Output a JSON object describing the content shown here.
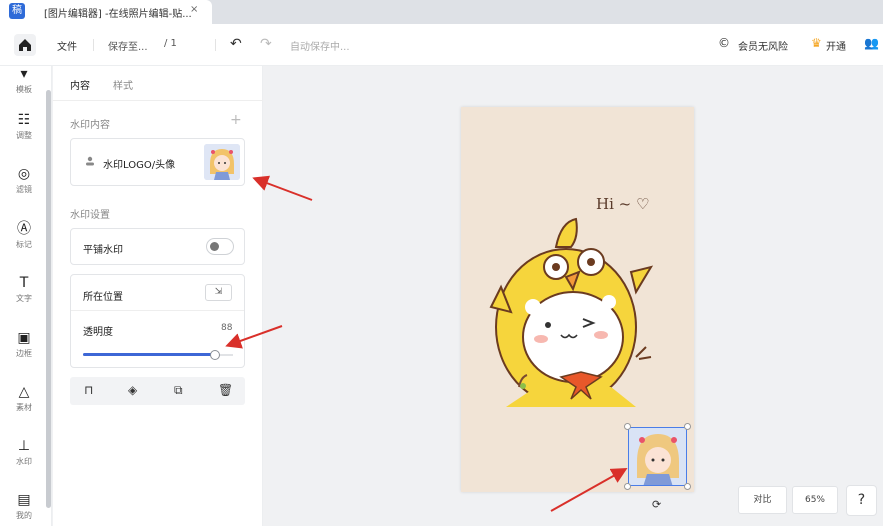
{
  "tab": {
    "logo": "稿",
    "title": "[图片编辑器] -在线照片编辑-贴...",
    "close": "×"
  },
  "toolbar": {
    "file": "文件",
    "save": "保存至...",
    "page": "/ 1",
    "undo": "↶",
    "redo": "↷",
    "autosave": "自动保存中...",
    "copyright_icon": "©",
    "member": "会员无风险",
    "vip_icon": "♛",
    "vip": "开通",
    "user_icon": "👥"
  },
  "nav": {
    "items": [
      {
        "icon": "▾",
        "label": "模板"
      },
      {
        "icon": "☷",
        "label": "调整"
      },
      {
        "icon": "◎",
        "label": "滤镜"
      },
      {
        "icon": "Ⓐ",
        "label": "标记"
      },
      {
        "icon": "T",
        "label": "文字"
      },
      {
        "icon": "▣",
        "label": "边框"
      },
      {
        "icon": "△",
        "label": "素材"
      },
      {
        "icon": "⊥",
        "label": "水印"
      },
      {
        "icon": "▤",
        "label": "我的"
      }
    ]
  },
  "panel": {
    "tabs": [
      "内容",
      "样式"
    ],
    "watermark_content": "水印内容",
    "plus": "+",
    "logo_label": "水印LOGO/头像",
    "watermark_settings": "水印设置",
    "tile": "平铺水印",
    "position": "所在位置",
    "position_icon": "⇲",
    "opacity": "透明度",
    "opacity_value": "88",
    "opacity_fraction": 0.88,
    "actions": [
      "⊓",
      "◈",
      "⧉",
      "🗑"
    ]
  },
  "artboard": {
    "text": "Hi ~ ♡"
  },
  "footer": {
    "rotate": "⟳",
    "compare": "对比",
    "zoom": "65%",
    "help": "?"
  },
  "colors": {
    "accent": "#3d67d6",
    "arrow": "#d9302a",
    "chick": "#f6d53c",
    "bow": "#e8582a"
  }
}
